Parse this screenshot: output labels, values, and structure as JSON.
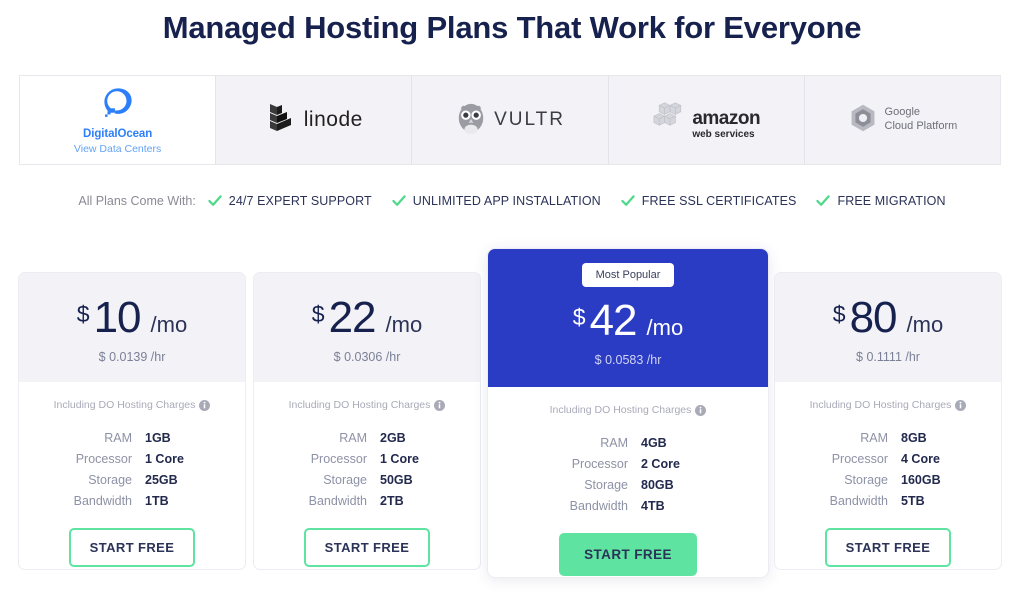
{
  "page_title": "Managed Hosting Plans That Work for Everyone",
  "colors": {
    "title_navy": "#16214d",
    "featured_blue": "#2b3cc4",
    "accent_green": "#5fe3a1",
    "do_blue": "#2d7ff9",
    "card_head_gray": "#f2f2f7",
    "muted_text": "#8d92a6"
  },
  "providers": {
    "tabs": [
      {
        "id": "digitalocean",
        "name": "DigitalOcean",
        "sub_link": "View Data Centers",
        "icon": "digitalocean-logo",
        "active": true
      },
      {
        "id": "linode",
        "name": "linode",
        "icon": "linode-logo",
        "active": false
      },
      {
        "id": "vultr",
        "name": "VULTR",
        "icon": "vultr-owl-logo",
        "active": false
      },
      {
        "id": "aws",
        "name_line1": "amazon",
        "name_line2": "web services",
        "icon": "aws-cubes-logo",
        "active": false
      },
      {
        "id": "gcp",
        "name_line1": "Google",
        "name_line2": "Cloud Platform",
        "icon": "google-cloud-hexagon-logo",
        "active": false
      }
    ]
  },
  "features_bar": {
    "label": "All Plans Come With:",
    "check_icon": "check-icon",
    "items": [
      "24/7 EXPERT SUPPORT",
      "UNLIMITED APP INSTALLATION",
      "FREE SSL CERTIFICATES",
      "FREE MIGRATION"
    ]
  },
  "common": {
    "currency_symbol": "$",
    "per_month": "/mo",
    "including_note": "Including DO Hosting Charges",
    "info_icon": "info-icon",
    "cta_label": "START FREE",
    "spec_labels": [
      "RAM",
      "Processor",
      "Storage",
      "Bandwidth"
    ]
  },
  "plans": [
    {
      "id": "plan-10",
      "price": "10",
      "hourly": "$ 0.0139 /hr",
      "featured": false,
      "specs": {
        "ram": "1GB",
        "processor": "1 Core",
        "storage": "25GB",
        "bandwidth": "1TB"
      }
    },
    {
      "id": "plan-22",
      "price": "22",
      "hourly": "$ 0.0306 /hr",
      "featured": false,
      "specs": {
        "ram": "2GB",
        "processor": "1 Core",
        "storage": "50GB",
        "bandwidth": "2TB"
      }
    },
    {
      "id": "plan-42",
      "price": "42",
      "hourly": "$ 0.0583 /hr",
      "featured": true,
      "badge": "Most Popular",
      "specs": {
        "ram": "4GB",
        "processor": "2 Core",
        "storage": "80GB",
        "bandwidth": "4TB"
      }
    },
    {
      "id": "plan-80",
      "price": "80",
      "hourly": "$ 0.1111 /hr",
      "featured": false,
      "specs": {
        "ram": "8GB",
        "processor": "4 Core",
        "storage": "160GB",
        "bandwidth": "5TB"
      }
    }
  ]
}
